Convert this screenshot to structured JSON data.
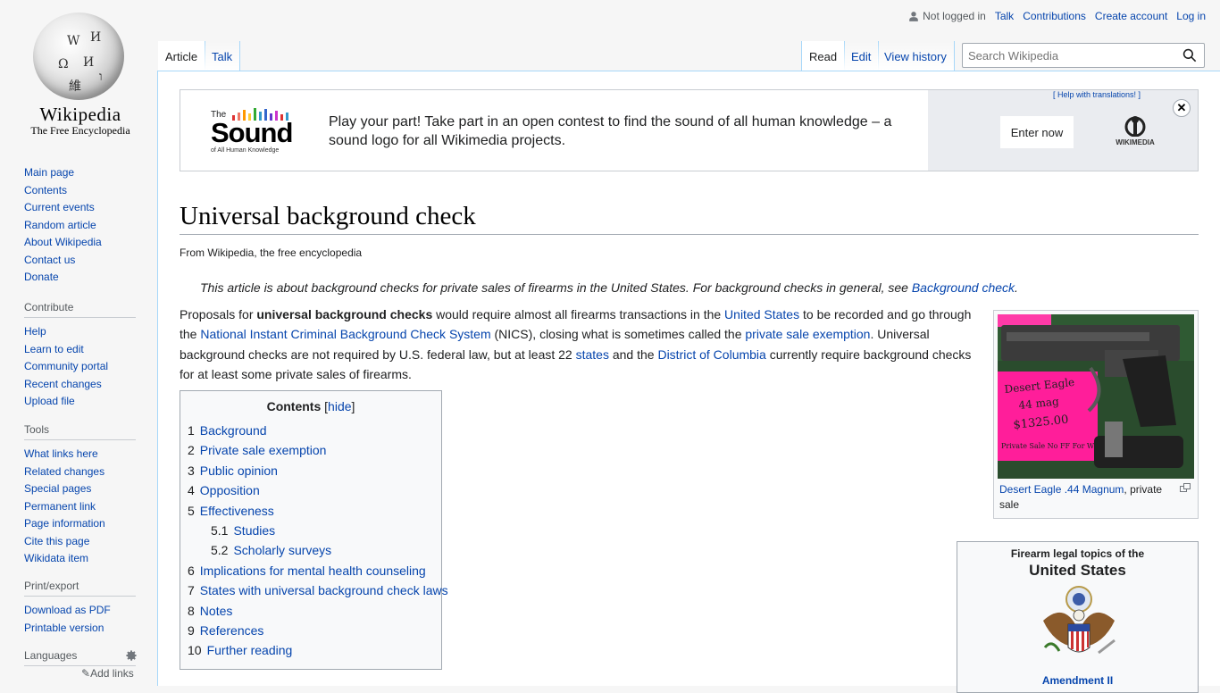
{
  "logo": {
    "wordmark": "Wikipedia",
    "tagline": "The Free Encyclopedia"
  },
  "sidebar": {
    "navigation": [
      "Main page",
      "Contents",
      "Current events",
      "Random article",
      "About Wikipedia",
      "Contact us",
      "Donate"
    ],
    "contribute": {
      "heading": "Contribute",
      "items": [
        "Help",
        "Learn to edit",
        "Community portal",
        "Recent changes",
        "Upload file"
      ]
    },
    "tools": {
      "heading": "Tools",
      "items": [
        "What links here",
        "Related changes",
        "Special pages",
        "Permanent link",
        "Page information",
        "Cite this page",
        "Wikidata item"
      ]
    },
    "print": {
      "heading": "Print/export",
      "items": [
        "Download as PDF",
        "Printable version"
      ]
    },
    "languages": {
      "heading": "Languages",
      "add_links": "Add links"
    }
  },
  "personal": {
    "not_logged_in": "Not logged in",
    "talk": "Talk",
    "contributions": "Contributions",
    "create_account": "Create account",
    "login": "Log in"
  },
  "tabs": {
    "article": "Article",
    "talk": "Talk",
    "read": "Read",
    "edit": "Edit",
    "history": "View history"
  },
  "search": {
    "placeholder": "Search Wikipedia"
  },
  "banner": {
    "help": "[ Help with translations! ]",
    "logo_the": "The",
    "logo_sound": "Sound",
    "logo_sub": "of All Human Knowledge",
    "message": "Play your part! Take part in an open contest to find the sound of all human knowledge – a sound logo for all Wikimedia projects.",
    "enter": "Enter now",
    "wikimedia": "WIKIMEDIA",
    "close": "✕"
  },
  "article": {
    "title": "Universal background check",
    "tagline": "From Wikipedia, the free encyclopedia",
    "hatnote_text": "This article is about background checks for private sales of firearms in the United States. For background checks in general, see ",
    "hatnote_link": "Background check",
    "hatnote_end": ".",
    "lead": {
      "t1": "Proposals for ",
      "b1": "universal background checks",
      "t2": " would require almost all firearms transactions in the ",
      "l1": "United States",
      "t3": " to be recorded and go through the ",
      "l2": "National Instant Criminal Background Check System",
      "t4": " (NICS), closing what is sometimes called the ",
      "l3": "private sale exemption",
      "t5": ". Universal background checks are not required by U.S. federal law, but at least 22 ",
      "l4": "states",
      "t6": " and the ",
      "l5": "District of Columbia",
      "t7": " currently require background checks for at least some private sales of firearms."
    }
  },
  "toc": {
    "title": "Contents",
    "hide": "hide",
    "items": [
      {
        "num": "1",
        "label": "Background"
      },
      {
        "num": "2",
        "label": "Private sale exemption"
      },
      {
        "num": "3",
        "label": "Public opinion"
      },
      {
        "num": "4",
        "label": "Opposition"
      },
      {
        "num": "5",
        "label": "Effectiveness"
      },
      {
        "num": "5.1",
        "label": "Studies"
      },
      {
        "num": "5.2",
        "label": "Scholarly surveys"
      },
      {
        "num": "6",
        "label": "Implications for mental health counseling"
      },
      {
        "num": "7",
        "label": "States with universal background check laws"
      },
      {
        "num": "8",
        "label": "Notes"
      },
      {
        "num": "9",
        "label": "References"
      },
      {
        "num": "10",
        "label": "Further reading"
      }
    ]
  },
  "thumb": {
    "caption_link": "Desert Eagle .44 Magnum",
    "caption_rest": ", private sale",
    "tag_line1": "Desert Eagle",
    "tag_line2": "44 mag",
    "tag_price": "$1325.00",
    "tag_note": "Private Sale  No FF For W"
  },
  "infobox": {
    "pre": "Firearm legal topics of the",
    "main": "United States",
    "amendment": "Amendment II"
  }
}
